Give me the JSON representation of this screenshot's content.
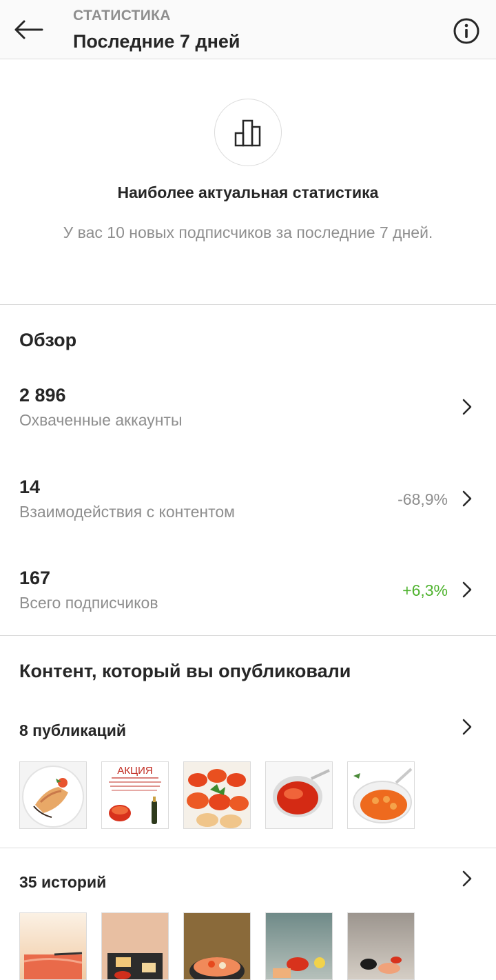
{
  "header": {
    "overline": "СТАТИСТИКА",
    "title": "Последние 7 дней",
    "back_icon": "arrow-left-icon",
    "info_icon": "info-icon"
  },
  "hero": {
    "icon": "bar-chart-icon",
    "title": "Наиболее актуальная статистика",
    "text": "У вас 10 новых подписчиков за последние 7 дней."
  },
  "overview": {
    "title": "Обзор",
    "stats": [
      {
        "value": "2 896",
        "label": "Охваченные аккаунты",
        "change": ""
      },
      {
        "value": "14",
        "label": "Взаимодействия с контентом",
        "change": "-68,9%"
      },
      {
        "value": "167",
        "label": "Всего подписчиков",
        "change": "+6,3%"
      }
    ]
  },
  "content": {
    "title": "Контент, который вы опубликовали",
    "posts": {
      "label": "8 публикаций",
      "thumbnails": [
        {
          "name": "salmon-pancake-plate"
        },
        {
          "name": "promo-caviar-flyer",
          "text": "АКЦИЯ"
        },
        {
          "name": "caviar-tartlets"
        },
        {
          "name": "red-caviar-jar"
        },
        {
          "name": "caviar-spoon-bowl"
        }
      ]
    },
    "stories": {
      "label": "35 историй",
      "thumbnails": [
        {
          "name": "salmon-fillet-story"
        },
        {
          "name": "caviar-board-story"
        },
        {
          "name": "poke-bowl-story"
        },
        {
          "name": "caviar-sandwiches-story"
        },
        {
          "name": "black-caviar-story"
        }
      ]
    }
  },
  "colors": {
    "negative": "#8e8e8e",
    "positive": "#4fb32f",
    "muted": "#8e8e8e",
    "divider": "#dbdbdb"
  }
}
